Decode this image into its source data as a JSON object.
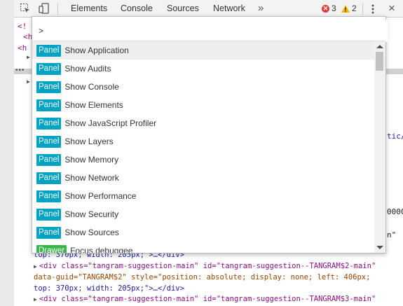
{
  "toolbar": {
    "tabs": [
      "Elements",
      "Console",
      "Sources",
      "Network"
    ],
    "more_label": "»",
    "errors_count": "3",
    "warnings_count": "2",
    "close_label": "×"
  },
  "code_fragments": {
    "left_1": "<!",
    "left_2": "<h",
    "left_3": "<h",
    "right_1": "tic/",
    "right_2": "0000",
    "right_3": "n\""
  },
  "code_lines": [
    {
      "tri": "",
      "tag1": "top: 370px; width: 205px;\">…</div>"
    },
    {
      "tri": "▶",
      "text": "<div class=\"tangram-suggestion-main\" id=\"tangram-suggestion--TANGRAM$2-main\""
    },
    {
      "tri": "",
      "text": "data-guid=\"TANGRAM$2\" style=\"position: absolute; display: none; left: 406px;"
    },
    {
      "tri": "",
      "text": "top: 370px; width: 205px;\">…</div>"
    },
    {
      "tri": "▶",
      "text": "<div class=\"tangram-suggestion-main\" id=\"tangram-suggestion--TANGRAM$3-main\""
    }
  ],
  "command_menu": {
    "input_value": ">",
    "items": [
      {
        "category": "Panel",
        "label": "Show Application"
      },
      {
        "category": "Panel",
        "label": "Show Audits"
      },
      {
        "category": "Panel",
        "label": "Show Console"
      },
      {
        "category": "Panel",
        "label": "Show Elements"
      },
      {
        "category": "Panel",
        "label": "Show JavaScript Profiler"
      },
      {
        "category": "Panel",
        "label": "Show Layers"
      },
      {
        "category": "Panel",
        "label": "Show Memory"
      },
      {
        "category": "Panel",
        "label": "Show Network"
      },
      {
        "category": "Panel",
        "label": "Show Performance"
      },
      {
        "category": "Panel",
        "label": "Show Security"
      },
      {
        "category": "Panel",
        "label": "Show Sources"
      },
      {
        "category": "Drawer",
        "label": "Focus debuggee"
      }
    ]
  },
  "colors": {
    "panel_badge": "#00a3c4",
    "drawer_badge": "#3ab54a",
    "error": "#e53935",
    "warning": "#f4b400"
  }
}
